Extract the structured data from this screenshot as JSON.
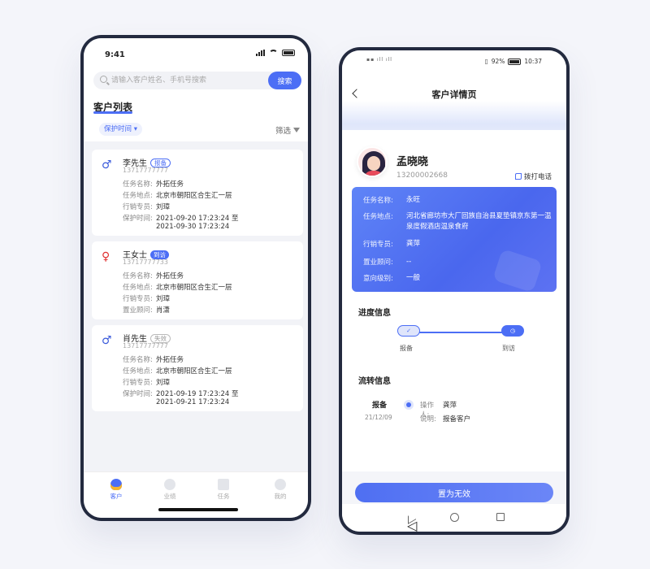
{
  "left_phone": {
    "status_time": "9:41",
    "search": {
      "placeholder": "请输入客户姓名、手机号搜索",
      "button": "搜索"
    },
    "title": "客户列表",
    "filter_pill": "保护时间",
    "filter_label": "筛选",
    "customers": [
      {
        "gender": "male",
        "name": "李先生",
        "badge": "报备",
        "phone": "13717777777",
        "fields": [
          {
            "k": "任务名称:",
            "v": "外拓任务"
          },
          {
            "k": "任务地点:",
            "v": "北京市朝阳区合生汇一层"
          },
          {
            "k": "行销专员:",
            "v": "刘璋"
          },
          {
            "k": "保护时间:",
            "v": "2021-09-20 17:23:24 至"
          },
          {
            "k": "",
            "v": "2021-09-30 17:23:24"
          }
        ]
      },
      {
        "gender": "female",
        "name": "王女士",
        "badge": "到访",
        "phone": "13717777733",
        "fields": [
          {
            "k": "任务名称:",
            "v": "外拓任务"
          },
          {
            "k": "任务地点:",
            "v": "北京市朝阳区合生汇一层"
          },
          {
            "k": "行销专员:",
            "v": "刘璋"
          },
          {
            "k": "置业顾问:",
            "v": "肖潇"
          }
        ]
      },
      {
        "gender": "male",
        "name": "肖先生",
        "badge": "失效",
        "phone": "13717777777",
        "fields": [
          {
            "k": "任务名称:",
            "v": "外拓任务"
          },
          {
            "k": "任务地点:",
            "v": "北京市朝阳区合生汇一层"
          },
          {
            "k": "行销专员:",
            "v": "刘璋"
          },
          {
            "k": "保护时间:",
            "v": "2021-09-19 17:23:24 至"
          },
          {
            "k": "",
            "v": "2021-09-21 17:23:24"
          }
        ]
      }
    ],
    "tabs": [
      "客户",
      "业绩",
      "任务",
      "我的"
    ]
  },
  "right_phone": {
    "status_battery": "92%",
    "status_time": "10:37",
    "page_title": "客户详情页",
    "customer_name": "孟晓晓",
    "customer_phone": "13200002668",
    "dial_label": "拨打电话",
    "info": [
      {
        "k": "任务名称:",
        "v": "永旺"
      },
      {
        "k": "任务地点:",
        "v": "河北省廊坊市大厂回族自治县夏垫镇京东第一温泉度假酒店温泉食府"
      },
      {
        "k": "行销专员:",
        "v": "龚萍"
      },
      {
        "k": "置业顾问:",
        "v": "--"
      },
      {
        "k": "意向级别:",
        "v": "一般"
      }
    ],
    "progress_title": "进度信息",
    "progress_steps": [
      "报备",
      "到访"
    ],
    "flow_title": "流转信息",
    "flow": {
      "stage": "报备",
      "date": "21/12/09",
      "operator_k": "操作人:",
      "operator_v": "龚萍",
      "note_k": "说明:",
      "note_v": "报备客户"
    },
    "invalid_button": "置为无效"
  },
  "colors": {
    "accent": "#4c6ef5",
    "male": "#3b5bdb",
    "female": "#e03131"
  }
}
